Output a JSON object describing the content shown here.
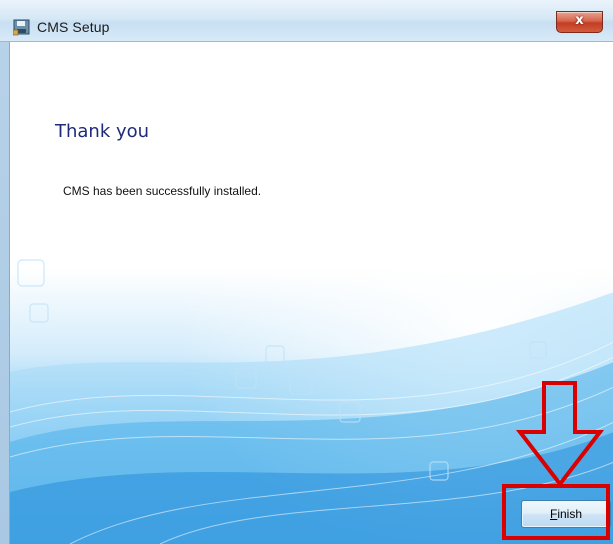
{
  "window": {
    "title": "CMS Setup",
    "close_label": "x"
  },
  "page": {
    "heading": "Thank you",
    "message": "CMS has been successfully installed."
  },
  "buttons": {
    "finish_first": "F",
    "finish_rest": "inish"
  },
  "colors": {
    "heading": "#1f2a7a",
    "annotation_red": "#d90000",
    "button_border": "#3c7fb1"
  },
  "icons": {
    "app": "setup-disk-icon",
    "close": "close-icon",
    "annotation_arrow": "down-arrow-annotation-icon"
  }
}
